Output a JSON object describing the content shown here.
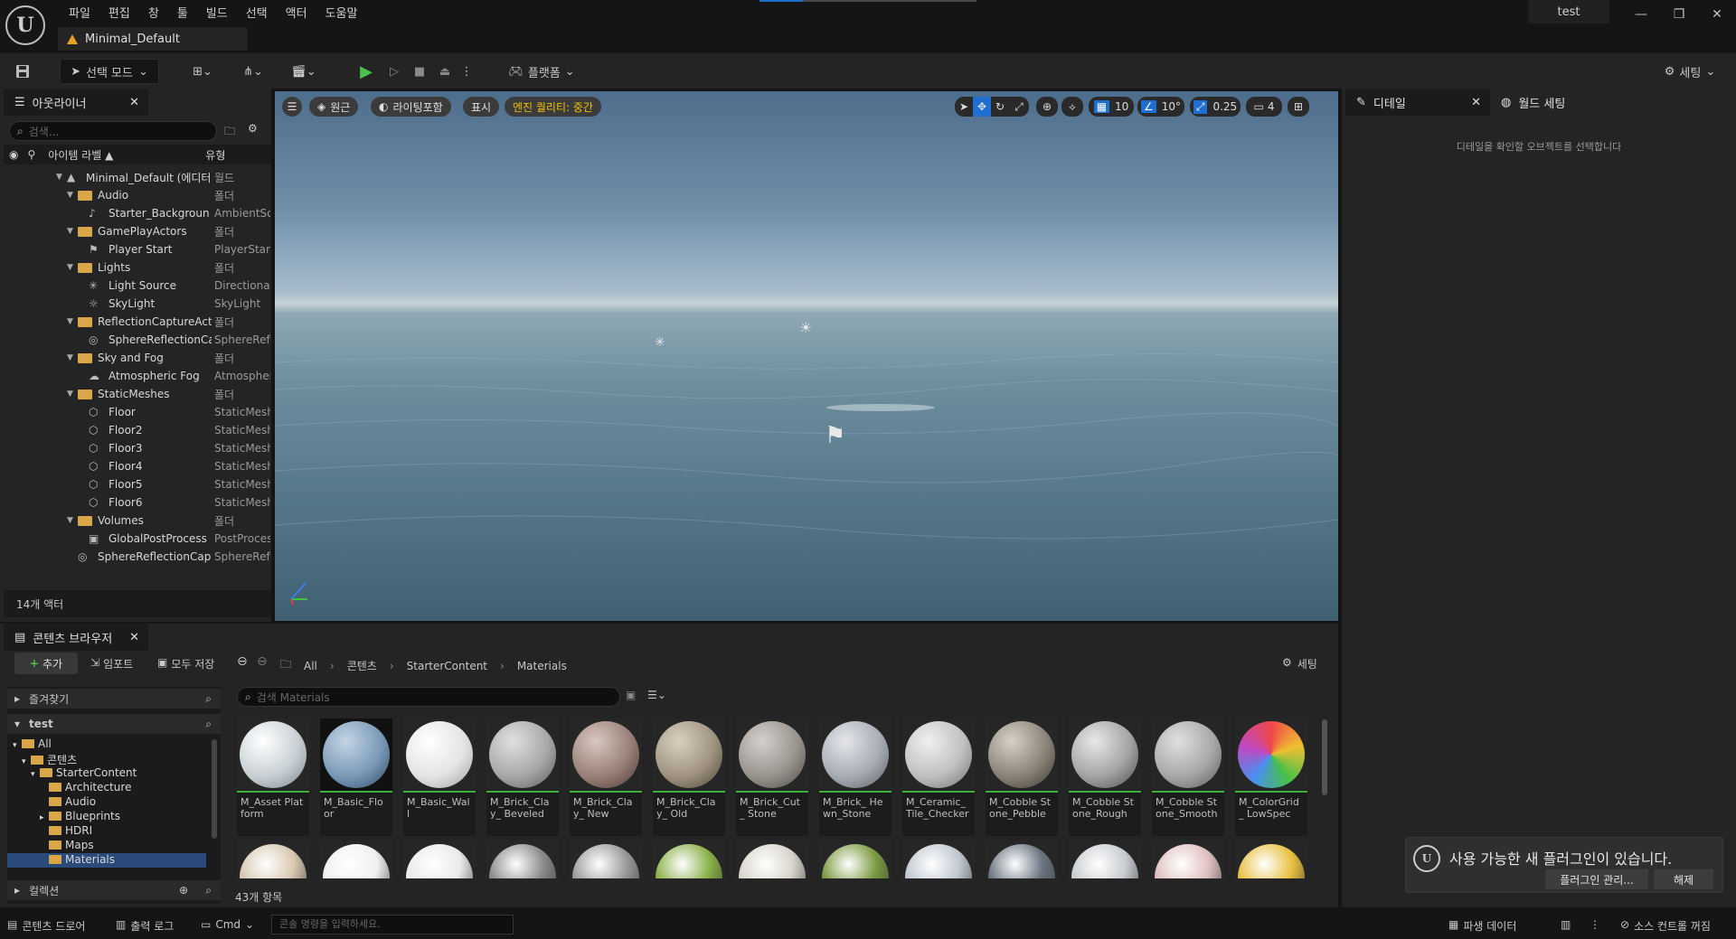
{
  "menu": [
    "파일",
    "편집",
    "창",
    "툴",
    "빌드",
    "선택",
    "액터",
    "도움말"
  ],
  "level_tab": "Minimal_Default",
  "project_name": "test",
  "window_controls": [
    "minimize-icon",
    "restore-icon",
    "close-icon"
  ],
  "toolbar": {
    "mode": "선택 모드",
    "platform": "플랫폼",
    "settings": "세팅"
  },
  "outliner": {
    "tab": "아웃라이너",
    "search_placeholder": "검색...",
    "col_label": "아이템 라벨 ▲",
    "col_type": "유형",
    "rows": [
      {
        "name": "Minimal_Default (에디터",
        "type": "월드",
        "kind": "world"
      },
      {
        "name": "Audio",
        "type": "폴더",
        "kind": "folder"
      },
      {
        "name": "Starter_Backgroun",
        "type": "AmbientSo",
        "kind": "sound"
      },
      {
        "name": "GamePlayActors",
        "type": "폴더",
        "kind": "folder"
      },
      {
        "name": "Player Start",
        "type": "PlayerStart",
        "kind": "player"
      },
      {
        "name": "Lights",
        "type": "폴더",
        "kind": "folder"
      },
      {
        "name": "Light Source",
        "type": "Directional",
        "kind": "light"
      },
      {
        "name": "SkyLight",
        "type": "SkyLight",
        "kind": "sky"
      },
      {
        "name": "ReflectionCaptureAct",
        "type": "폴더",
        "kind": "folder"
      },
      {
        "name": "SphereReflectionCa",
        "type": "SphereRefl",
        "kind": "reflect"
      },
      {
        "name": "Sky and Fog",
        "type": "폴더",
        "kind": "folder"
      },
      {
        "name": "Atmospheric Fog",
        "type": "Atmospher",
        "kind": "fog"
      },
      {
        "name": "StaticMeshes",
        "type": "폴더",
        "kind": "folder"
      },
      {
        "name": "Floor",
        "type": "StaticMesh",
        "kind": "mesh"
      },
      {
        "name": "Floor2",
        "type": "StaticMesh",
        "kind": "mesh"
      },
      {
        "name": "Floor3",
        "type": "StaticMesh",
        "kind": "mesh"
      },
      {
        "name": "Floor4",
        "type": "StaticMesh",
        "kind": "mesh"
      },
      {
        "name": "Floor5",
        "type": "StaticMesh",
        "kind": "mesh"
      },
      {
        "name": "Floor6",
        "type": "StaticMesh",
        "kind": "mesh"
      },
      {
        "name": "Volumes",
        "type": "폴더",
        "kind": "folder"
      },
      {
        "name": "GlobalPostProcess",
        "type": "PostProces",
        "kind": "post"
      },
      {
        "name": "SphereReflectionCap",
        "type": "SphereRefl",
        "kind": "reflect"
      }
    ],
    "count": "14개 액터"
  },
  "viewport": {
    "perspective": "원근",
    "lit": "라이팅포함",
    "show": "표시",
    "quality": "엔진 퀄리티: 중간",
    "grid": "10",
    "angle": "10°",
    "scale": "0.25",
    "camera": "4"
  },
  "details": {
    "tab1": "디테일",
    "tab2": "월드 세팅",
    "empty": "디테일을 확인할 오브젝트를 선택합니다"
  },
  "content_browser": {
    "tab": "콘텐츠 브라우저",
    "add": "추가",
    "import": "임포트",
    "save_all": "모두 저장",
    "path": [
      "All",
      "콘텐츠",
      "StarterContent",
      "Materials"
    ],
    "settings": "세팅",
    "favorites": "즐겨찾기",
    "project": "test",
    "tree": [
      "All",
      "콘텐츠",
      "StarterContent",
      "Architecture",
      "Audio",
      "Blueprints",
      "HDRI",
      "Maps",
      "Materials"
    ],
    "collections": "컬렉션",
    "search_placeholder": "검색 Materials",
    "assets": [
      "M_Asset Platform",
      "M_Basic_Floor",
      "M_Basic_Wall",
      "M_Brick_Clay_ Beveled",
      "M_Brick_Clay_ New",
      "M_Brick_Clay_ Old",
      "M_Brick_Cut_ Stone",
      "M_Brick_ Hewn_Stone",
      "M_Ceramic_ Tile_Checker",
      "M_Cobble Stone_Pebble",
      "M_Cobble Stone_Rough",
      "M_Cobble Stone_Smooth",
      "M_ColorGrid_ LowSpec"
    ],
    "count": "43개 항목"
  },
  "notification": {
    "text": "사용 가능한 새 플러그인이 있습니다.",
    "manage": "플러그인 관리...",
    "dismiss": "해제"
  },
  "statusbar": {
    "drawer": "콘텐츠 드로어",
    "log": "출력 로그",
    "cmd": "Cmd",
    "console_placeholder": "콘솔 명령을 입력하세요.",
    "derived": "파생 데이터",
    "source_control": "소스 컨트롤 꺼짐"
  }
}
